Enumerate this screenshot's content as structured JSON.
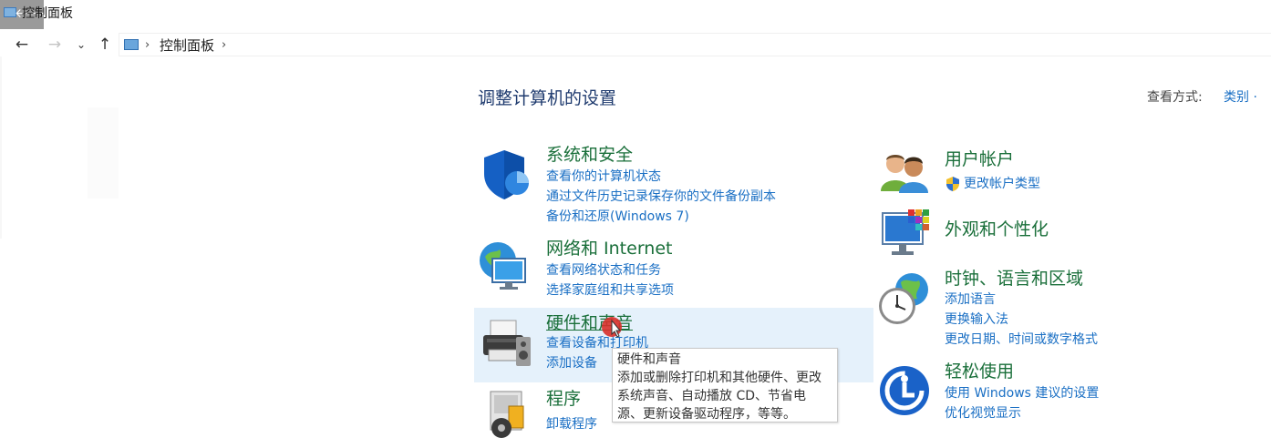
{
  "window": {
    "title": "控制面板",
    "back_glyph": "🡐"
  },
  "nav": {
    "back": "←",
    "forward": "→",
    "recent": "⌄",
    "up": "↑",
    "breadcrumb": "控制面板",
    "sep": "›"
  },
  "main": {
    "heading": "调整计算机的设置",
    "view_by_label": "查看方式:",
    "view_by_value": "类别 ·"
  },
  "categories": {
    "system_security": {
      "title": "系统和安全",
      "links": [
        "查看你的计算机状态",
        "通过文件历史记录保存你的文件备份副本",
        "备份和还原(Windows 7)"
      ]
    },
    "network": {
      "title": "网络和 Internet",
      "links": [
        "查看网络状态和任务",
        "选择家庭组和共享选项"
      ]
    },
    "hardware": {
      "title": "硬件和声音",
      "links": [
        "查看设备和打印机",
        "添加设备"
      ]
    },
    "programs": {
      "title": "程序",
      "links": [
        "卸载程序"
      ]
    },
    "user_accounts": {
      "title": "用户帐户",
      "links": [
        "更改帐户类型"
      ]
    },
    "appearance": {
      "title": "外观和个性化",
      "links": []
    },
    "clock_region": {
      "title": "时钟、语言和区域",
      "links": [
        "添加语言",
        "更换输入法",
        "更改日期、时间或数字格式"
      ]
    },
    "ease_access": {
      "title": "轻松使用",
      "links": [
        "使用 Windows 建议的设置",
        "优化视觉显示"
      ]
    }
  },
  "tooltip": {
    "lines": [
      "硬件和声音",
      "添加或删除打印机和其他硬件、更改",
      "系统声音、自动播放 CD、节省电",
      "源、更新设备驱动程序，等等。"
    ]
  },
  "colors": {
    "category_title": "#1a6f3a",
    "link": "#1a6fc4",
    "heading": "#1e3a6e",
    "hover_bg": "#e5f1fb"
  }
}
